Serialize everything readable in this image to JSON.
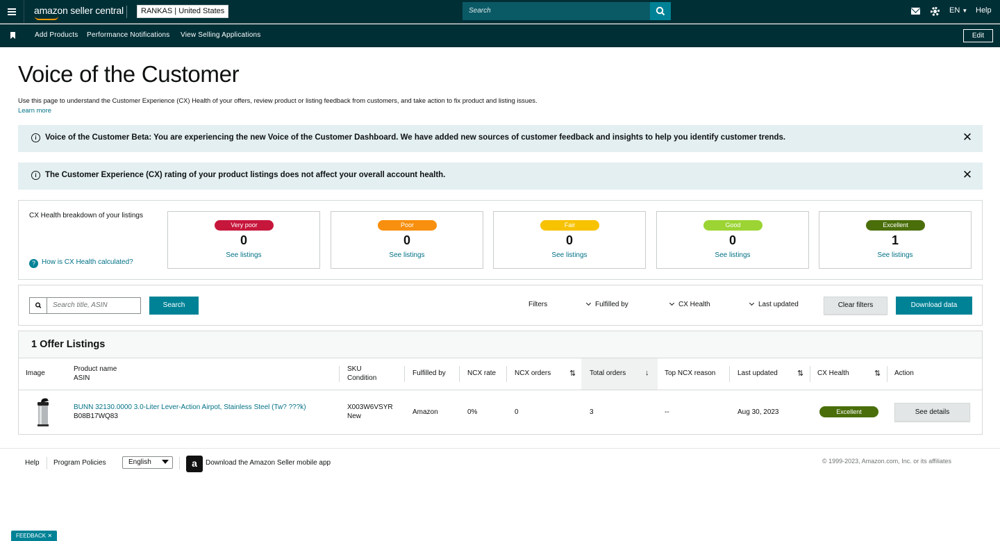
{
  "header": {
    "logo_text": "amazon seller central",
    "store_selector": "RANKAS | United States",
    "search_placeholder": "Search",
    "language": "EN",
    "help": "Help"
  },
  "subnav": {
    "links": [
      "Add Products",
      "Performance Notifications",
      "View Selling Applications"
    ],
    "edit": "Edit"
  },
  "page": {
    "title": "Voice of the Customer",
    "intro": "Use this page to understand the Customer Experience (CX) Health of your offers, review product or listing feedback from customers, and take action to fix product and listing issues.",
    "learn_more": "Learn more"
  },
  "banners": [
    "Voice of the Customer Beta: You are experiencing the new Voice of the Customer Dashboard. We have added new sources of customer feedback and insights to help you identify customer trends.",
    "The Customer Experience (CX) rating of your product listings does not affect your overall account health."
  ],
  "cx_health": {
    "heading": "CX Health breakdown of your listings",
    "how_link": "How is CX Health calculated?",
    "cards": [
      {
        "label": "Very poor",
        "count": "0",
        "link": "See listings",
        "color": "#c7163c"
      },
      {
        "label": "Poor",
        "count": "0",
        "link": "See listings",
        "color": "#f88f0e"
      },
      {
        "label": "Fair",
        "count": "0",
        "link": "See listings",
        "color": "#f7c200"
      },
      {
        "label": "Good",
        "count": "0",
        "link": "See listings",
        "color": "#9bd433"
      },
      {
        "label": "Excellent",
        "count": "1",
        "link": "See listings",
        "color": "#4a6e0a"
      }
    ]
  },
  "filters": {
    "search_placeholder": "Search title, ASIN",
    "search_button": "Search",
    "label": "Filters",
    "fulfilled_by": "Fulfilled by",
    "cx_health": "CX Health",
    "last_updated": "Last updated",
    "clear": "Clear filters",
    "download": "Download data"
  },
  "table": {
    "title": "1 Offer Listings",
    "headers": {
      "image": "Image",
      "product_name": "Product name",
      "asin": "ASIN",
      "sku": "SKU",
      "condition": "Condition",
      "fulfilled_by": "Fulfilled by",
      "ncx_rate": "NCX rate",
      "ncx_orders": "NCX orders",
      "total_orders": "Total orders",
      "top_reason": "Top NCX reason",
      "last_updated": "Last updated",
      "cx_health": "CX Health",
      "action": "Action"
    },
    "rows": [
      {
        "product_name": "BUNN 32130.0000 3.0-Liter Lever-Action Airpot, Stainless Steel (Tw? ???k)",
        "asin": "B08B17WQ83",
        "sku": "X003W6VSYR",
        "condition": "New",
        "fulfilled_by": "Amazon",
        "ncx_rate": "0%",
        "ncx_orders": "0",
        "total_orders": "3",
        "top_reason": "--",
        "last_updated": "Aug 30, 2023",
        "cx_health": "Excellent",
        "action": "See details"
      }
    ]
  },
  "footer": {
    "help": "Help",
    "program_policies": "Program Policies",
    "language": "English",
    "app": "Download the Amazon Seller mobile app",
    "copyright": "© 1999-2023, Amazon.com, Inc. or its affiliates",
    "feedback": "FEEDBACK ✕"
  }
}
